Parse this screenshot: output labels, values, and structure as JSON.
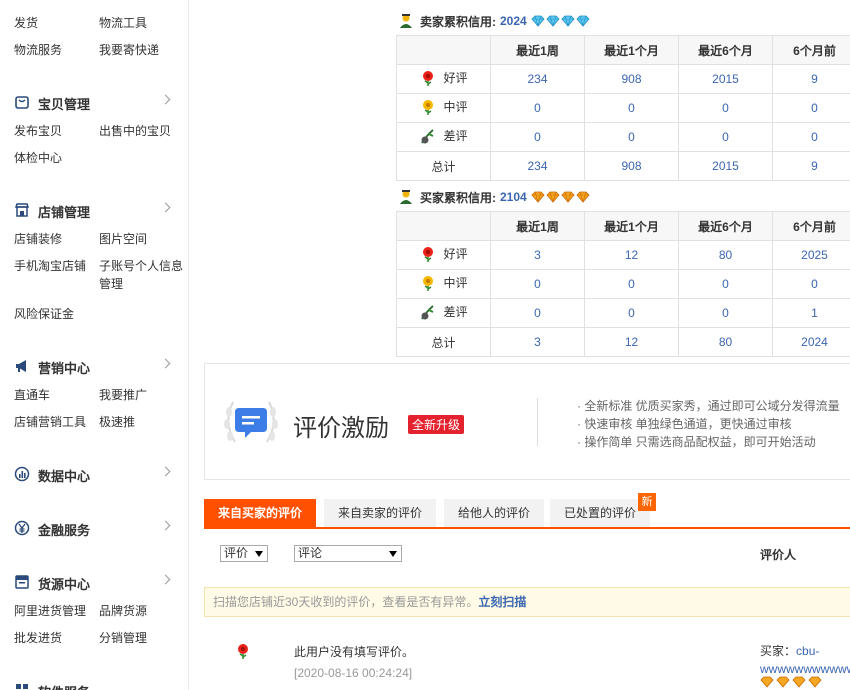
{
  "sidebar": {
    "top_links": [
      "发货",
      "物流工具",
      "物流服务",
      "我要寄快递"
    ],
    "sections": [
      {
        "title": "宝贝管理",
        "icon": "bag-icon",
        "links": [
          "发布宝贝",
          "出售中的宝贝",
          "体检中心"
        ]
      },
      {
        "title": "店铺管理",
        "icon": "shop-icon",
        "links": [
          "店铺装修",
          "图片空间",
          "手机淘宝店铺",
          "子账号个人信息管理",
          "风险保证金"
        ]
      },
      {
        "title": "营销中心",
        "icon": "megaphone-icon",
        "links": [
          "直通车",
          "我要推广",
          "店铺营销工具",
          "极速推"
        ]
      },
      {
        "title": "数据中心",
        "icon": "chart-icon",
        "links": []
      },
      {
        "title": "金融服务",
        "icon": "yen-icon",
        "links": []
      },
      {
        "title": "货源中心",
        "icon": "box-icon",
        "links": [
          "阿里进货管理",
          "品牌货源",
          "批发进货",
          "分销管理"
        ]
      },
      {
        "title": "软件服务",
        "icon": "app-icon",
        "links": []
      }
    ]
  },
  "seller_credit": {
    "label": "卖家累积信用:",
    "score": "2024",
    "columns": [
      "",
      "最近1周",
      "最近1个月",
      "最近6个月",
      "6个月前"
    ],
    "rows": [
      {
        "label": "好评",
        "values": [
          "234",
          "908",
          "2015",
          "9"
        ]
      },
      {
        "label": "中评",
        "values": [
          "0",
          "0",
          "0",
          "0"
        ]
      },
      {
        "label": "差评",
        "values": [
          "0",
          "0",
          "0",
          "0"
        ]
      },
      {
        "label": "总计",
        "values": [
          "234",
          "908",
          "2015",
          "9"
        ]
      }
    ]
  },
  "buyer_credit": {
    "label": "买家累积信用:",
    "score": "2104",
    "columns": [
      "",
      "最近1周",
      "最近1个月",
      "最近6个月",
      "6个月前"
    ],
    "rows": [
      {
        "label": "好评",
        "values": [
          "3",
          "12",
          "80",
          "2025"
        ]
      },
      {
        "label": "中评",
        "values": [
          "0",
          "0",
          "0",
          "0"
        ]
      },
      {
        "label": "差评",
        "values": [
          "0",
          "0",
          "0",
          "1"
        ]
      },
      {
        "label": "总计",
        "values": [
          "3",
          "12",
          "80",
          "2024"
        ]
      }
    ]
  },
  "banner": {
    "title": "评价激励",
    "badge": "全新升级",
    "bullets": [
      "· 全新标准 优质买家秀，通过即可公域分发得流量",
      "· 快速审核 单独绿色通道，更快通过审核",
      "· 操作简单 只需选商品配权益，即可开始活动"
    ]
  },
  "tabs": {
    "items": [
      "来自买家的评价",
      "来自卖家的评价",
      "给他人的评价",
      "已处置的评价"
    ],
    "new_badge": "新"
  },
  "filters": {
    "rating_select": "评价",
    "comment_select": "评论",
    "reviewer_header": "评价人"
  },
  "notice": {
    "text": "扫描您店铺近30天收到的评价，查看是否有异常。",
    "link": "立刻扫描"
  },
  "review": {
    "text": "此用户没有填写评价。",
    "date": "[2020-08-16 00:24:24]",
    "buyer_prefix": "买家：",
    "buyer_name": "cbu-",
    "buyer_name2": "wwwwwwwwwwwww"
  },
  "colors": {
    "accent": "#ff5000",
    "link": "#3b66b0",
    "badge": "#e4222e"
  }
}
